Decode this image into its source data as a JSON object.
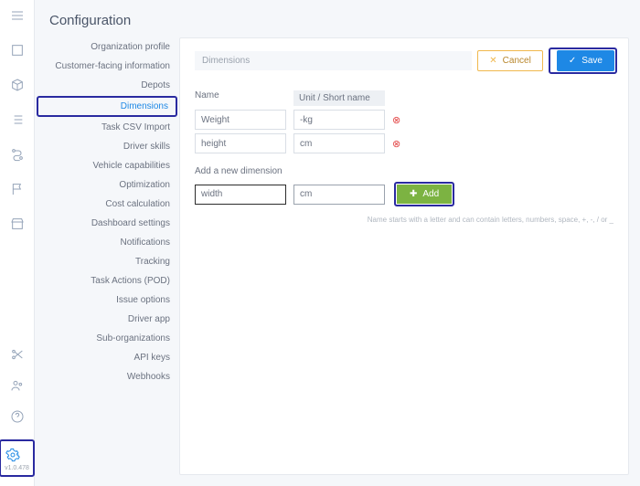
{
  "page": {
    "title": "Configuration"
  },
  "sidebar": {
    "items": [
      {
        "label": "Organization profile"
      },
      {
        "label": "Customer-facing information"
      },
      {
        "label": "Depots"
      },
      {
        "label": "Dimensions",
        "active": true
      },
      {
        "label": "Task CSV Import"
      },
      {
        "label": "Driver skills"
      },
      {
        "label": "Vehicle capabilities"
      },
      {
        "label": "Optimization"
      },
      {
        "label": "Cost calculation"
      },
      {
        "label": "Dashboard settings"
      },
      {
        "label": "Notifications"
      },
      {
        "label": "Tracking"
      },
      {
        "label": "Task Actions (POD)"
      },
      {
        "label": "Issue options"
      },
      {
        "label": "Driver app"
      },
      {
        "label": "Sub-organizations"
      },
      {
        "label": "API keys"
      },
      {
        "label": "Webhooks"
      }
    ]
  },
  "panel": {
    "title": "Dimensions",
    "cancel": "Cancel",
    "save": "Save",
    "headers": {
      "name": "Name",
      "unit": "Unit / Short name"
    },
    "rows": [
      {
        "name": "Weight",
        "unit": "-kg"
      },
      {
        "name": "height",
        "unit": "cm"
      }
    ],
    "add_label": "Add a new dimension",
    "new_name": "width",
    "new_unit": "cm",
    "add_btn": "Add",
    "hint": "Name starts with a letter and can contain letters, numbers, space, +, -, / or _"
  },
  "rail": {
    "version": "v1.0.478"
  }
}
